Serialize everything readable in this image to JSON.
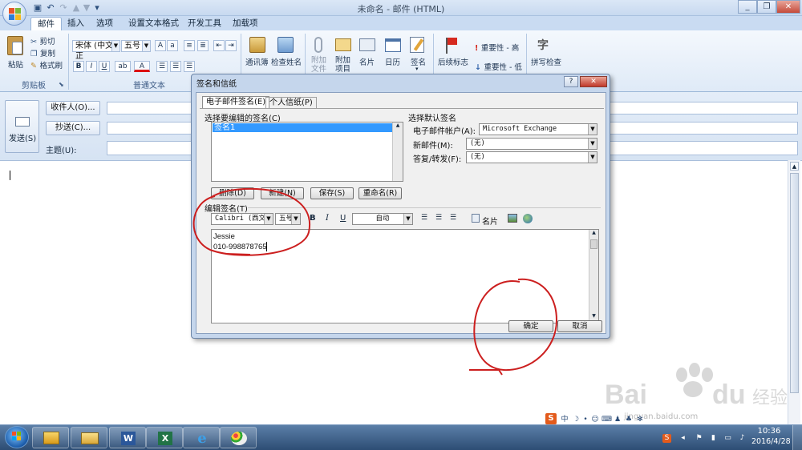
{
  "window": {
    "title": "未命名 - 邮件 (HTML)",
    "quick_access": [
      "save-icon",
      "undo-icon",
      "redo-icon",
      "up-arrow-icon",
      "down-arrow-icon",
      "customize-icon"
    ],
    "buttons": [
      "minimize",
      "maximize",
      "close"
    ]
  },
  "tabs": [
    {
      "label": "邮件",
      "active": true
    },
    {
      "label": "插入"
    },
    {
      "label": "选项"
    },
    {
      "label": "设置文本格式"
    },
    {
      "label": "开发工具"
    },
    {
      "label": "加载项"
    }
  ],
  "ribbon": {
    "clipboard": {
      "paste": "粘贴",
      "cut": "剪切",
      "copy": "复制",
      "format_painter": "格式刷",
      "group": "剪贴板"
    },
    "basic_text": {
      "font": "宋体 (中文正",
      "size": "五号",
      "bold": "B",
      "italic": "I",
      "underline": "U",
      "group": "普通文本"
    },
    "names": {
      "address_book": "通讯簿",
      "check_names": "检查姓名"
    },
    "include": {
      "attach_file": "附加文件",
      "attach_item": "附加项目",
      "business_card": "名片",
      "calendar": "日历",
      "signature": "签名"
    },
    "options": {
      "follow_up": "后续标志",
      "high_importance": "重要性 - 高",
      "low_importance": "重要性 - 低"
    },
    "proofing": {
      "spelling": "拼写检查"
    }
  },
  "header": {
    "send": "发送(S)",
    "to": "收件人(O)...",
    "cc": "抄送(C)...",
    "subject_label": "主题(U):"
  },
  "dialog": {
    "title": "签名和信纸",
    "tabs": [
      {
        "label": "电子邮件签名(E)",
        "active": true
      },
      {
        "label": "个人信纸(P)"
      }
    ],
    "select_label": "选择要编辑的签名(C)",
    "signatures": [
      "签名1"
    ],
    "buttons": {
      "delete": "删除(D)",
      "new": "新建(N)",
      "save": "保存(S)",
      "rename": "重命名(R)"
    },
    "defaults": {
      "section": "选择默认签名",
      "account_label": "电子邮件帐户(A):",
      "account_value": "Microsoft Exchange",
      "new_msg_label": "新邮件(M):",
      "new_msg_value": "(无)",
      "reply_label": "答复/转发(F):",
      "reply_value": "(无)"
    },
    "edit_label": "编辑签名(T)",
    "edit_toolbar": {
      "font": "Calibri (西文正",
      "size": "五号",
      "bold": "B",
      "italic": "I",
      "underline": "U",
      "color": "自动",
      "business_card": "名片"
    },
    "signature_lines": [
      "Jessie",
      "010-998878765"
    ],
    "ok": "确定",
    "cancel": "取消"
  },
  "taskbar": {
    "apps": [
      "start",
      "outlook",
      "explorer",
      "word",
      "excel",
      "ie",
      "paint"
    ],
    "ime": "中",
    "time": "10:36",
    "date": "2016/4/28"
  },
  "watermark": "jingyan.baidu.com",
  "colors": {
    "accent": "#1f5fa8",
    "annotation": "#cc1f1f",
    "ribbon": "#dfeaf7"
  }
}
